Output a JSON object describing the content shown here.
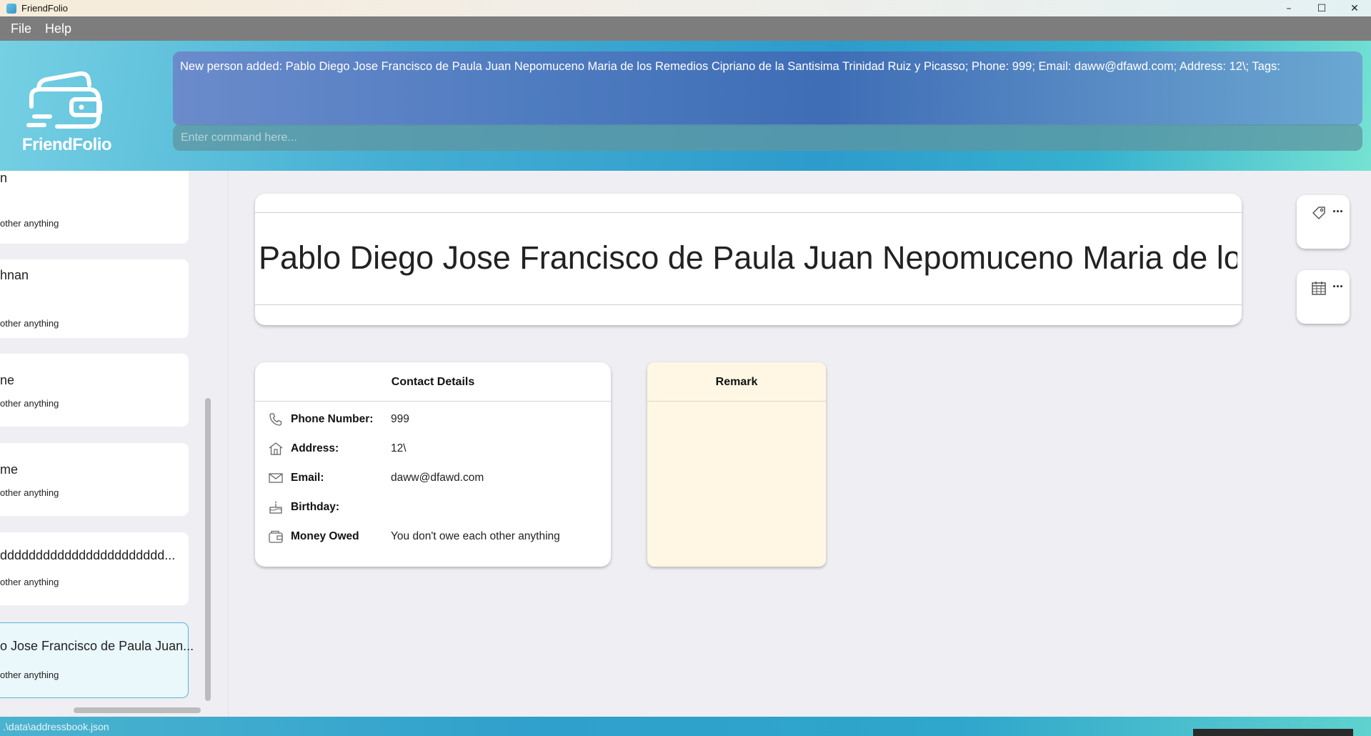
{
  "window": {
    "title": "FriendFolio",
    "controls": [
      "–",
      "☐",
      "✕"
    ]
  },
  "menu": {
    "items": [
      "File",
      "Help"
    ]
  },
  "logo": {
    "text": "FriendFolio"
  },
  "result_display": {
    "text": "New person added: Pablo Diego Jose Francisco de Paula Juan Nepomuceno Maria de los Remedios Cipriano de la Santisima Trinidad Ruiz y Picasso; Phone: 999; Email: daww@dfawd.com; Address: 12\\; Tags:"
  },
  "command_box": {
    "placeholder": "Enter command here..."
  },
  "person_list": {
    "items": [
      {
        "name": "n",
        "owe": "other anything",
        "selected": false
      },
      {
        "name": "hnan",
        "owe": "other anything",
        "selected": false
      },
      {
        "name": "ne",
        "owe": "other anything",
        "selected": false
      },
      {
        "name": "me",
        "owe": "other anything",
        "selected": false
      },
      {
        "name": "ddddddddddddddddddddddd...",
        "owe": "other anything",
        "selected": false
      },
      {
        "name": "o Jose Francisco de Paula Juan...",
        "owe": "other anything",
        "selected": true
      }
    ]
  },
  "detail": {
    "name": "Pablo Diego Jose Francisco de Paula Juan Nepomuceno Maria de lo...",
    "side_widgets": [
      {
        "icon": "tag-icon",
        "more": "..."
      },
      {
        "icon": "calendar-icon",
        "more": "..."
      }
    ],
    "contact": {
      "title": "Contact Details",
      "rows": [
        {
          "icon": "phone-icon",
          "label": "Phone Number:",
          "value": "999"
        },
        {
          "icon": "home-icon",
          "label": "Address:",
          "value": "12\\"
        },
        {
          "icon": "mail-icon",
          "label": "Email:",
          "value": "daww@dfawd.com"
        },
        {
          "icon": "cake-icon",
          "label": "Birthday:",
          "value": ""
        },
        {
          "icon": "wallet-icon",
          "label": "Money Owed",
          "value": "You don't owe each other anything"
        }
      ]
    },
    "remark": {
      "title": "Remark",
      "text": ""
    }
  },
  "status_bar": {
    "path": ".\\data\\addressbook.json"
  },
  "colors": {
    "accent": "#2d9bcc",
    "menubar": "#7d7d7d",
    "remark_bg": "#fff7e3",
    "selected_border": "#58b6dc"
  }
}
